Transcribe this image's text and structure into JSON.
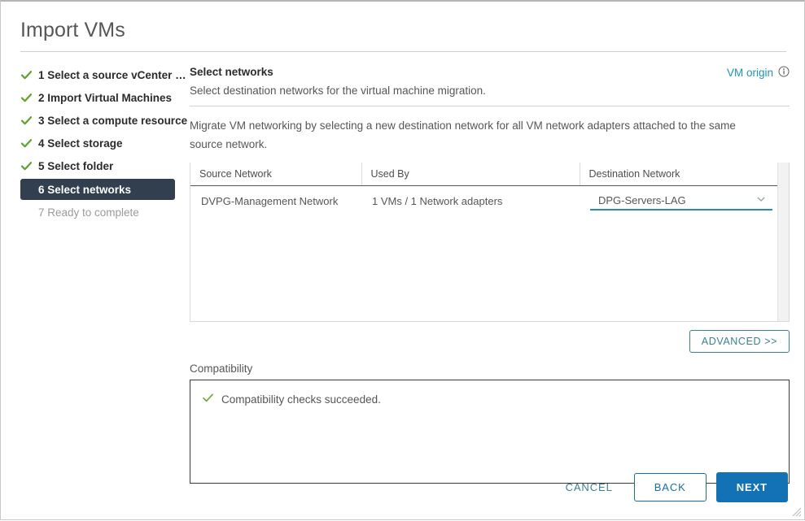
{
  "window": {
    "title": "Import VMs"
  },
  "sidebar": {
    "steps": [
      {
        "label": "1 Select a source vCenter S…",
        "state": "done",
        "icon": "check-icon"
      },
      {
        "label": "2 Import Virtual Machines",
        "state": "done",
        "icon": "check-icon"
      },
      {
        "label": "3 Select a compute resource",
        "state": "done",
        "icon": "check-icon"
      },
      {
        "label": "4 Select storage",
        "state": "done",
        "icon": "check-icon"
      },
      {
        "label": "5 Select folder",
        "state": "done",
        "icon": "check-icon"
      },
      {
        "label": "6 Select networks",
        "state": "active",
        "icon": ""
      },
      {
        "label": "7 Ready to complete",
        "state": "pending",
        "icon": ""
      }
    ]
  },
  "main": {
    "section_title": "Select networks",
    "section_subtitle": "Select destination networks for the virtual machine migration.",
    "vm_origin_label": "VM origin",
    "vm_origin_icon": "info-circle-icon",
    "intro": "Migrate VM networking by selecting a new destination network for all VM network adapters attached to the same source network.",
    "table": {
      "columns": [
        "Source Network",
        "Used By",
        "Destination Network"
      ],
      "rows": [
        {
          "source_network": "DVPG-Management Network",
          "used_by": "1 VMs / 1 Network adapters",
          "destination_network": "DPG-Servers-LAG",
          "dropdown_icon": "chevron-down-icon"
        }
      ]
    },
    "advanced_label": "ADVANCED >>",
    "compatibility": {
      "label": "Compatibility",
      "status_icon": "check-icon",
      "status_text": "Compatibility checks succeeded."
    }
  },
  "footer": {
    "cancel_label": "CANCEL",
    "back_label": "BACK",
    "next_label": "NEXT"
  },
  "colors": {
    "accent_teal": "#1f93b8",
    "link_teal": "#3c7f94",
    "primary_blue": "#1272b3",
    "active_step_bg": "#313f4e",
    "success_green": "#5fa22d",
    "dropdown_underline": "#2a8ba6"
  }
}
